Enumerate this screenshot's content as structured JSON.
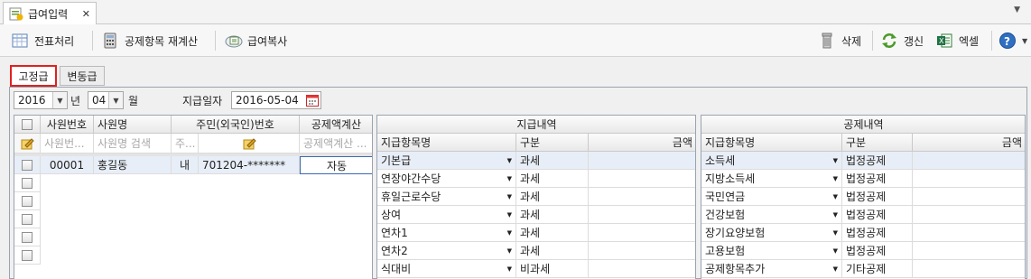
{
  "window": {
    "tab_title": "급여입력",
    "close_glyph": "✕"
  },
  "toolbar": {
    "voucher": "전표처리",
    "recalc": "공제항목 재계산",
    "copy": "급여복사",
    "delete": "삭제",
    "refresh": "갱신",
    "excel": "엑셀"
  },
  "tabs": {
    "fixed": "고정급",
    "variable": "변동급"
  },
  "filter": {
    "year": "2016",
    "year_unit": "년",
    "month": "04",
    "month_unit": "월",
    "pay_date_label": "지급일자",
    "pay_date": "2016-05-04"
  },
  "employees": {
    "headers": {
      "emp_no": "사원번호",
      "emp_name": "사원명",
      "reg_no": "주민(외국인)번호",
      "deduct_calc": "공제액계산"
    },
    "filters": {
      "emp_no": "사원번...",
      "emp_name": "사원명 검색",
      "reg_type": "주...",
      "deduct_calc": "공제액계산 ..."
    },
    "rows": [
      {
        "emp_no": "00001",
        "name": "홍길동",
        "type": "내",
        "reg_no": "701204-*******",
        "calc": "자동"
      }
    ]
  },
  "payments": {
    "title": "지급내역",
    "headers": {
      "item": "지급항목명",
      "category": "구분",
      "amount": "금액"
    },
    "rows": [
      {
        "item": "기본급",
        "category": "과세"
      },
      {
        "item": "연장야간수당",
        "category": "과세"
      },
      {
        "item": "휴일근로수당",
        "category": "과세"
      },
      {
        "item": "상여",
        "category": "과세"
      },
      {
        "item": "연차1",
        "category": "과세"
      },
      {
        "item": "연차2",
        "category": "과세"
      },
      {
        "item": "식대비",
        "category": "비과세"
      }
    ]
  },
  "deductions": {
    "title": "공제내역",
    "headers": {
      "item": "지급항목명",
      "category": "구분",
      "amount": "금액"
    },
    "rows": [
      {
        "item": "소득세",
        "category": "법정공제"
      },
      {
        "item": "지방소득세",
        "category": "법정공제"
      },
      {
        "item": "국민연금",
        "category": "법정공제"
      },
      {
        "item": "건강보험",
        "category": "법정공제"
      },
      {
        "item": "장기요양보험",
        "category": "법정공제"
      },
      {
        "item": "고용보험",
        "category": "법정공제"
      },
      {
        "item": "공제항목추가",
        "category": "기타공제"
      }
    ]
  },
  "colors": {
    "accent_red": "#e02020",
    "selected_row": "#e8eef7"
  }
}
